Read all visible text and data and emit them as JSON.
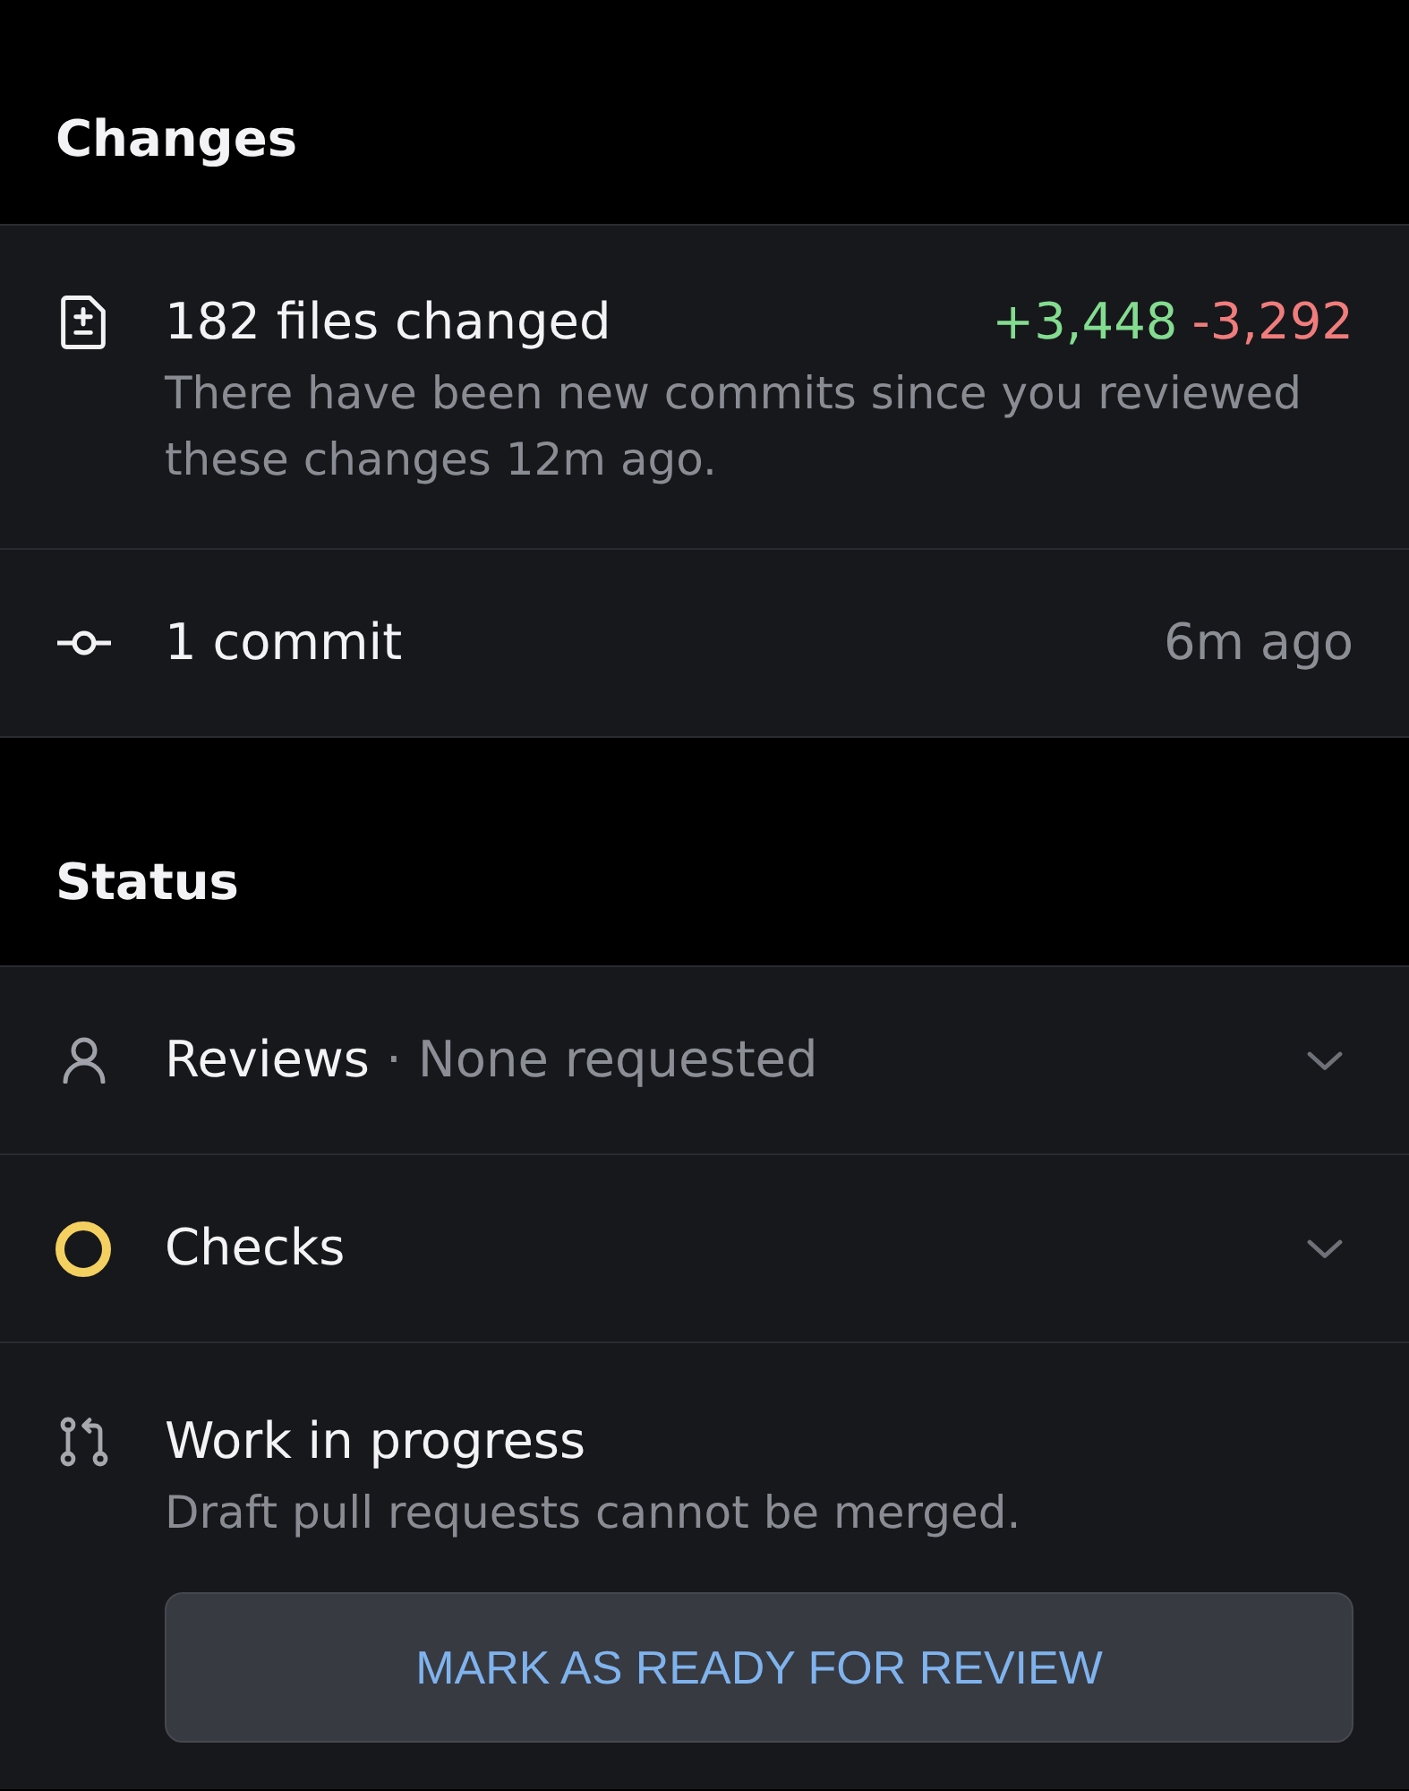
{
  "changes": {
    "title": "Changes",
    "files": {
      "label": "182 files changed",
      "additions": "+3,448",
      "deletions": "-3,292",
      "note": "There have been new commits since you reviewed these changes 12m ago."
    },
    "commits": {
      "label": "1 commit",
      "time": "6m ago"
    }
  },
  "status": {
    "title": "Status",
    "items": [
      {
        "kind": "reviews",
        "label": "Reviews",
        "separator": "·",
        "detail": "None requested",
        "expanded": false
      },
      {
        "kind": "checks",
        "label": "Checks",
        "color": "#f4d060",
        "expanded": false
      },
      {
        "kind": "draft",
        "label": "Work in progress",
        "note": "Draft pull requests cannot be merged.",
        "button": "MARK AS READY FOR REVIEW"
      }
    ]
  }
}
